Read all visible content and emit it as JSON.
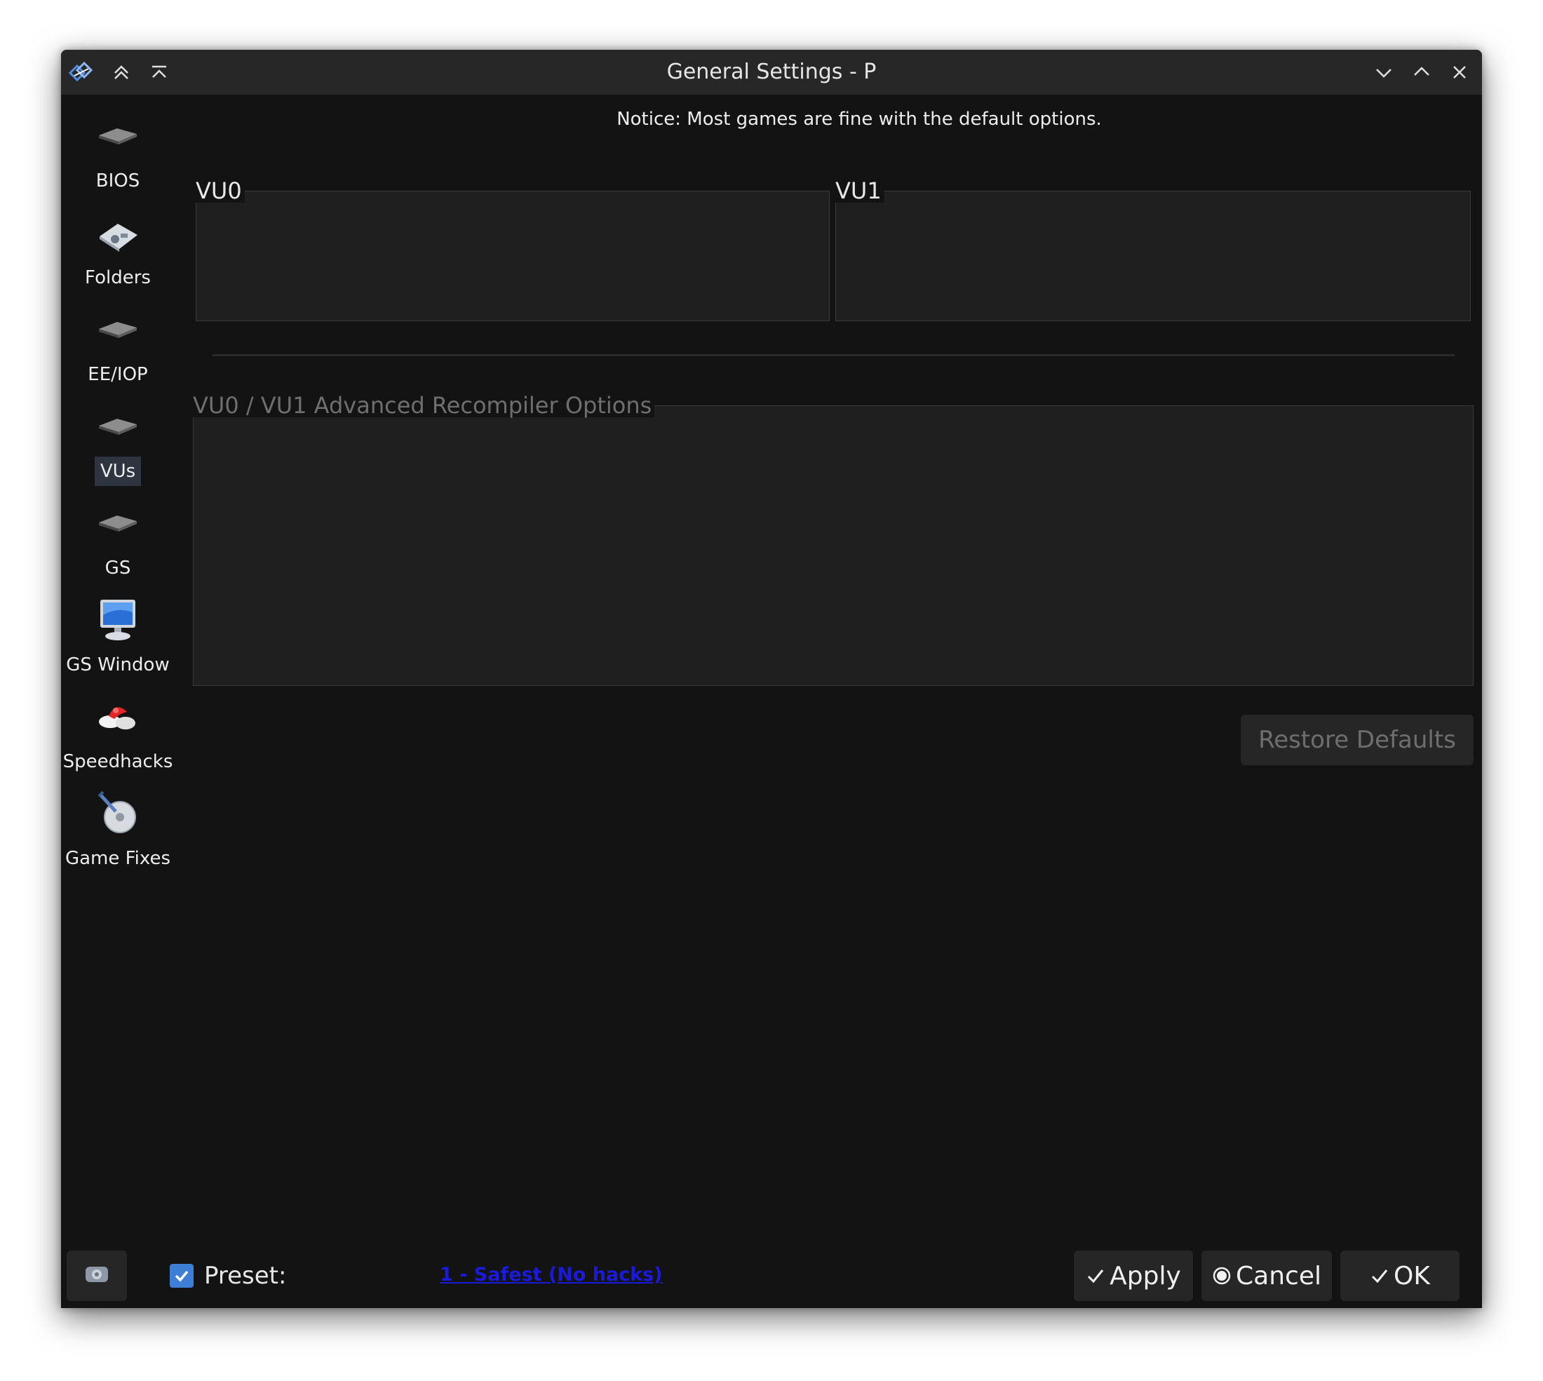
{
  "window": {
    "title": "General Settings - P"
  },
  "notice": "Notice: Most games are fine with the default options.",
  "sidebar": {
    "items": [
      {
        "label": "BIOS",
        "icon": "chip-icon"
      },
      {
        "label": "Folders",
        "icon": "folders-icon"
      },
      {
        "label": "EE/IOP",
        "icon": "chip-icon"
      },
      {
        "label": "VUs",
        "icon": "chip-icon",
        "selected": true
      },
      {
        "label": "GS",
        "icon": "chip-icon"
      },
      {
        "label": "GS Window",
        "icon": "monitor-icon"
      },
      {
        "label": "Speedhacks",
        "icon": "speedhacks-icon"
      },
      {
        "label": "Game Fixes",
        "icon": "game-fixes-icon"
      }
    ]
  },
  "groups": {
    "vu0_title": "VU0",
    "vu1_title": "VU1",
    "advanced_title": "VU0 / VU1 Advanced Recompiler Options"
  },
  "buttons": {
    "restore_defaults": "Restore Defaults",
    "apply": "Apply",
    "cancel": "Cancel",
    "ok": "OK"
  },
  "preset": {
    "label": "Preset:",
    "checked": true,
    "value": "1 - Safest (No hacks)"
  },
  "colors": {
    "window_bg": "#131313",
    "titlebar_bg": "#272727",
    "accent": "#3d7fd6",
    "preset_link": "#1a1adc"
  }
}
